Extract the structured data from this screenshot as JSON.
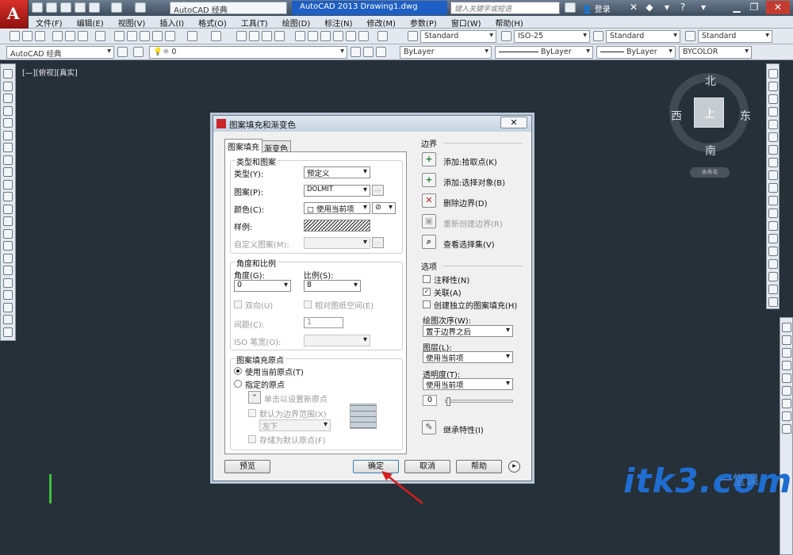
{
  "titlebar": {
    "workspace": "AutoCAD 经典",
    "app_title": "AutoCAD 2013    Drawing1.dwg",
    "search_placeholder": "键入关键字或短语",
    "login": "登录"
  },
  "menu": [
    "文件(F)",
    "编辑(E)",
    "视图(V)",
    "插入(I)",
    "格式(O)",
    "工具(T)",
    "绘图(D)",
    "标注(N)",
    "修改(M)",
    "参数(P)",
    "窗口(W)",
    "帮助(H)"
  ],
  "toolbar": {
    "text_style": "Standard",
    "dim_style": "ISO-25",
    "table_style": "Standard",
    "mleader_style": "Standard",
    "workspace2": "AutoCAD 经典",
    "layer": "0",
    "color": "ByLayer",
    "linetype": "ByLayer",
    "lineweight": "ByLayer",
    "plotstyle": "BYCOLOR"
  },
  "viewport_label": "[—][俯视][真实]",
  "viewcube": {
    "north": "北",
    "south": "南",
    "east": "东",
    "west": "西",
    "top": "上",
    "ucs": "未命名"
  },
  "dialog": {
    "title": "图案填充和渐变色",
    "tabs": [
      "图案填充",
      "渐变色"
    ],
    "type_pattern": {
      "group": "类型和图案",
      "type_label": "类型(Y):",
      "type_value": "预定义",
      "pattern_label": "图案(P):",
      "pattern_value": "DOLMIT",
      "color_label": "颜色(C):",
      "color_value": "使用当前项",
      "swatch_label": "样例:",
      "custom_label": "自定义图案(M):"
    },
    "angle_scale": {
      "group": "角度和比例",
      "angle_label": "角度(G):",
      "angle_value": "0",
      "scale_label": "比例(S):",
      "scale_value": "8",
      "double_label": "双向(U)",
      "relative_label": "相对图纸空间(E)",
      "spacing_label": "间距(C):",
      "spacing_value": "1",
      "iso_label": "ISO 笔宽(O):"
    },
    "origin": {
      "group": "图案填充原点",
      "use_current": "使用当前原点(T)",
      "specified": "指定的原点",
      "click_set": "单击以设置新原点",
      "default_extent": "默认为边界范围(X)",
      "extent_value": "左下",
      "store_default": "存储为默认原点(F)"
    },
    "boundaries": {
      "title": "边界",
      "add_pick": "添加:拾取点(K)",
      "add_select": "添加:选择对象(B)",
      "remove": "删除边界(D)",
      "recreate": "重新创建边界(R)",
      "view_selection": "查看选择集(V)"
    },
    "options": {
      "title": "选项",
      "annotative": "注释性(N)",
      "associative": "关联(A)",
      "separate": "创建独立的图案填充(H)",
      "draw_order_label": "绘图次序(W):",
      "draw_order_value": "置于边界之后",
      "layer_label": "图层(L):",
      "layer_value": "使用当前项",
      "transparency_label": "透明度(T):",
      "transparency_value": "使用当前项",
      "transparency_amount": "0"
    },
    "inherit": "继承特性(I)",
    "buttons": {
      "preview": "预览",
      "ok": "确定",
      "cancel": "取消",
      "help": "帮助"
    }
  },
  "watermark": {
    "domain": "itk3.com",
    "cn": "一堂课"
  }
}
